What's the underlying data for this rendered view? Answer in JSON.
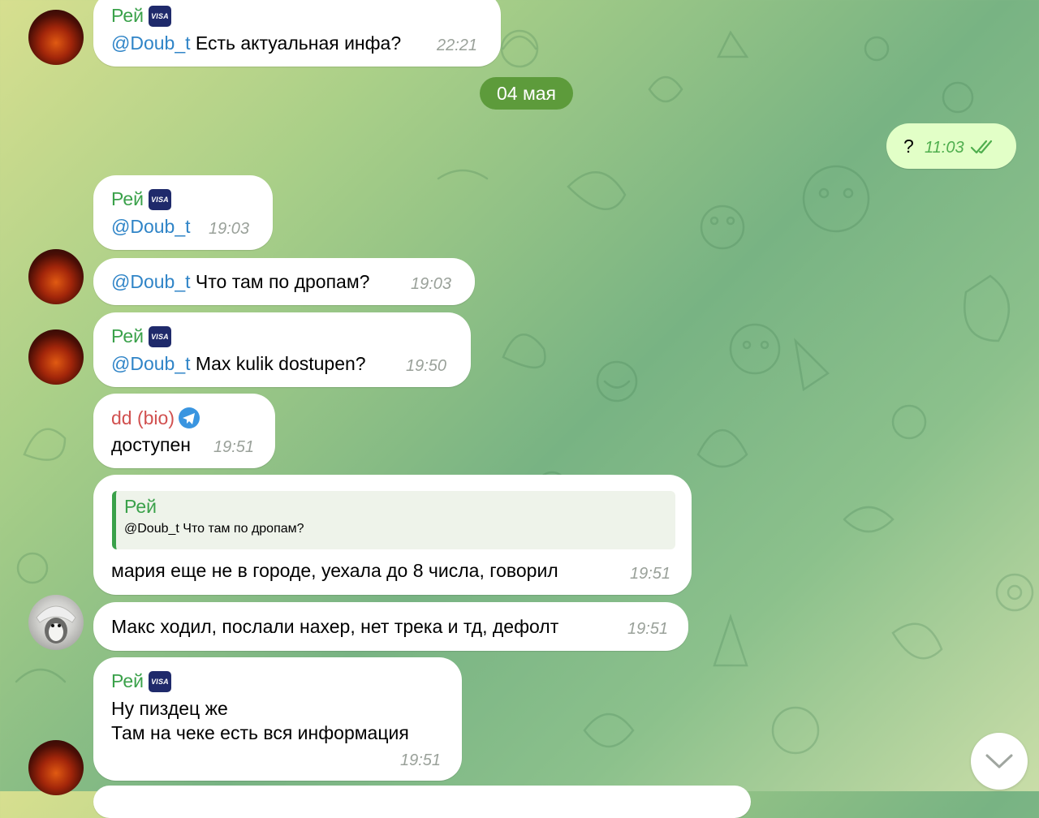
{
  "date_separator": "04 мая",
  "messages": [
    {
      "sender": "Рей",
      "badge": "VISA",
      "mention": "@Doub_t",
      "text": " Есть актуальная инфа?",
      "time": "22:21"
    },
    {
      "text": "?",
      "time": "11:03",
      "status": "read"
    },
    {
      "sender": "Рей",
      "badge": "VISA",
      "mention": "@Doub_t",
      "text": "",
      "time": "19:03"
    },
    {
      "mention": "@Doub_t",
      "text": " Что там по дропам?",
      "time": "19:03"
    },
    {
      "sender": "Рей",
      "badge": "VISA",
      "mention": "@Doub_t",
      "text": " Max kulik dostupen?",
      "time": "19:50"
    },
    {
      "sender": "dd (bio)",
      "text": "доступен",
      "time": "19:51"
    },
    {
      "quote_sender": "Рей",
      "quote_text": "@Doub_t Что там по дропам?",
      "text": "мария еще не в городе, уехала до 8 числа, говорил",
      "time": "19:51"
    },
    {
      "text": "Макс ходил, послали нахер, нет трека и тд, дефолт",
      "time": "19:51"
    },
    {
      "sender": "Рей",
      "badge": "VISA",
      "lines": [
        "Ну пиздец же",
        "Там на чеке есть вся информация"
      ],
      "time": "19:51"
    }
  ],
  "colors": {
    "sender_green": "#3aa14a",
    "sender_red": "#d1504f",
    "mention_blue": "#2f84c7",
    "outgoing_bubble": "#e2ffc7",
    "date_pill": "#5d9b3b"
  },
  "icons": {
    "verified": "telegram-plane-icon",
    "read_status": "double-check-icon",
    "scroll_down": "chevron-down-icon"
  }
}
